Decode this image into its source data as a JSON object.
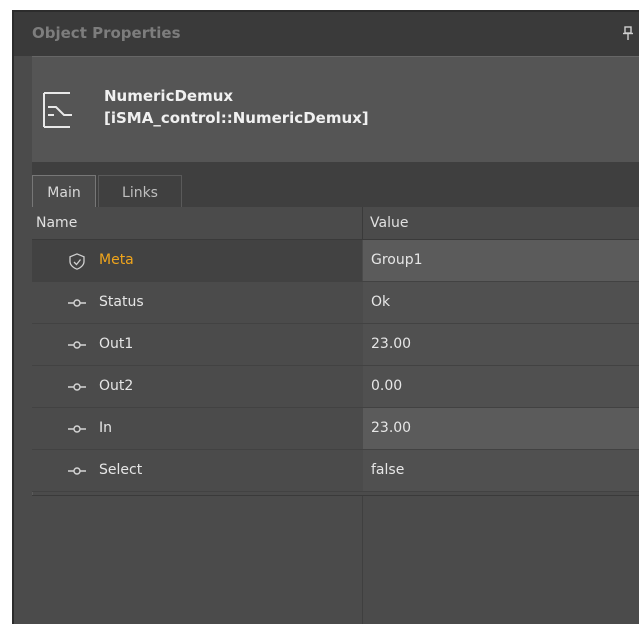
{
  "panel": {
    "title": "Object Properties"
  },
  "object": {
    "name": "NumericDemux",
    "type": "[iSMA_control::NumericDemux]"
  },
  "tabs": [
    {
      "label": "Main"
    },
    {
      "label": "Links"
    }
  ],
  "grid": {
    "columns": {
      "name": "Name",
      "value": "Value"
    },
    "rows": [
      {
        "name": "Meta",
        "value": "Group1",
        "icon": "shield-check-icon"
      },
      {
        "name": "Status",
        "value": "Ok",
        "icon": "slot-icon"
      },
      {
        "name": "Out1",
        "value": "23.00",
        "icon": "slot-icon"
      },
      {
        "name": "Out2",
        "value": "0.00",
        "icon": "slot-icon"
      },
      {
        "name": "In",
        "value": "23.00",
        "icon": "slot-icon"
      },
      {
        "name": "Select",
        "value": "false",
        "icon": "slot-icon"
      }
    ]
  },
  "colors": {
    "meta_label": "#f0a51c",
    "background": "#4b4b4b"
  }
}
